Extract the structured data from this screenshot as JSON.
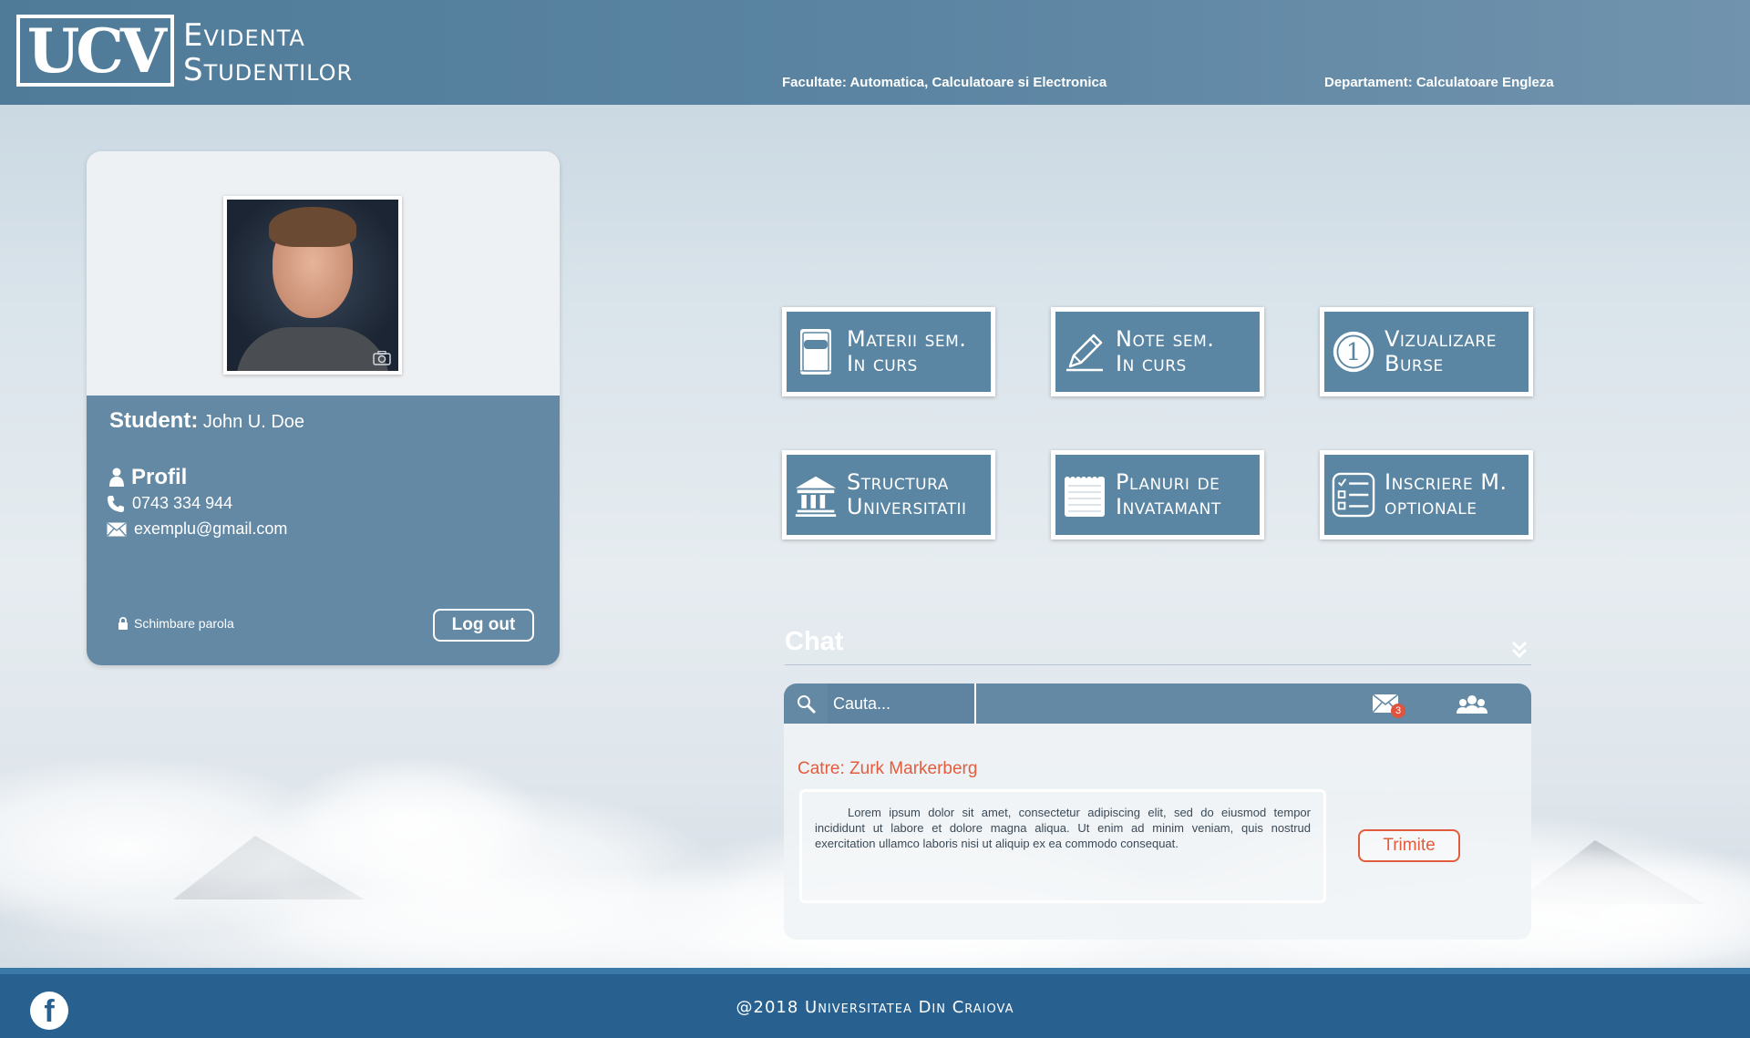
{
  "header": {
    "logo": "UCV",
    "brand_line1": "Evidenta",
    "brand_line2": "Studentilor",
    "faculty": "Facultate: Automatica, Calculatoare si Electronica",
    "department": "Departament: Calculatoare Engleza"
  },
  "profile": {
    "student_label": "Student:",
    "student_name": "John U. Doe",
    "profile_heading": "Profil",
    "phone": "0743 334 944",
    "email": "exemplu@gmail.com",
    "change_password": "Schimbare parola",
    "logout": "Log out"
  },
  "tiles": [
    {
      "line1": "Materii sem.",
      "line2": "In curs",
      "icon": "book-icon"
    },
    {
      "line1": "Note sem.",
      "line2": "In curs",
      "icon": "pencil-icon"
    },
    {
      "line1": "Vizualizare",
      "line2": "Burse",
      "icon": "coin-icon"
    },
    {
      "line1": "Structura",
      "line2": "Universitatii",
      "icon": "university-icon"
    },
    {
      "line1": "Planuri de",
      "line2": "Invatamant",
      "icon": "notepad-icon"
    },
    {
      "line1": "Inscriere M.",
      "line2": "optionale",
      "icon": "checklist-icon"
    }
  ],
  "chat": {
    "title": "Chat",
    "search_placeholder": "Cauta...",
    "unread_count": "3",
    "recipient": "Catre: Zurk Markerberg",
    "message": "Lorem ipsum dolor sit amet, consectetur adipiscing elit, sed do eiusmod tempor incididunt ut labore et dolore magna aliqua. Ut enim ad minim veniam, quis nostrud exercitation ullamco laboris nisi ut aliquip ex ea commodo consequat.",
    "send": "Trimite"
  },
  "footer": {
    "facebook": "f",
    "copyright": "@2018 Universitatea Din Craiova"
  },
  "colors": {
    "header": "#5a84a2",
    "tile": "#5a85a3",
    "accent": "#e25c3e",
    "footer": "#28618f"
  }
}
